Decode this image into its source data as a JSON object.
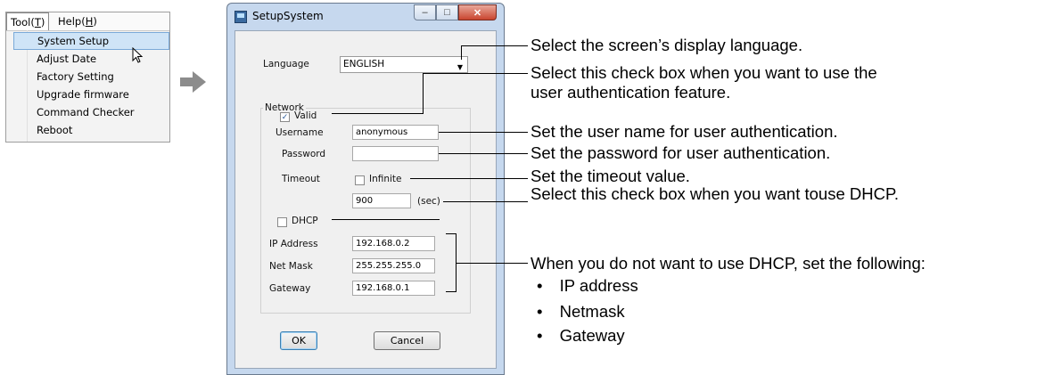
{
  "menu": {
    "bar": [
      {
        "label": "Tool(",
        "key": "T",
        "rest": ")"
      },
      {
        "label": "Help(",
        "key": "H",
        "rest": ")"
      }
    ],
    "items": [
      "System Setup",
      "Adjust Date",
      "Factory Setting",
      "Upgrade firmware",
      "Command Checker",
      "Reboot"
    ],
    "selected_index": 0
  },
  "dialog": {
    "title": "SetupSystem",
    "window_buttons": {
      "minimize": "–",
      "maximize": "□",
      "close": "✕"
    },
    "language_label": "Language",
    "language_value": "ENGLISH",
    "network_label": "Network",
    "valid_label": "Valid",
    "valid_checked": true,
    "username_label": "Username",
    "username_value": "anonymous",
    "password_label": "Password",
    "password_value": "",
    "timeout_label": "Timeout",
    "infinite_label": "Infinite",
    "infinite_checked": false,
    "timeout_value": "900",
    "timeout_unit": "(sec)",
    "dhcp_label": "DHCP",
    "dhcp_checked": false,
    "ip_label": "IP Address",
    "ip_value": "192.168.0.2",
    "netmask_label": "Net Mask",
    "netmask_value": "255.255.255.0",
    "gateway_label": "Gateway",
    "gateway_value": "192.168.0.1",
    "ok_label": "OK",
    "cancel_label": "Cancel"
  },
  "annotations": {
    "language": "Select the screen’s display language.",
    "auth_line1": "Select this check box when you want to use the",
    "auth_line2": "user authentication feature.",
    "username": "Set the user name for user authentication.",
    "password": "Set the password for user authentication.",
    "timeout": "Set the timeout value.",
    "dhcp": "Select this check box when you want touse DHCP.",
    "manual": "When you do not want to use DHCP, set the following:",
    "bullet_char": "•",
    "bullets": [
      "IP address",
      "Netmask",
      "Gateway"
    ]
  },
  "colors": {
    "menu_highlight": "#cfe4f7",
    "dialog_frame": "#c6d8ee",
    "close_button": "#c9452f",
    "checkmark": "#2b5b9a"
  }
}
